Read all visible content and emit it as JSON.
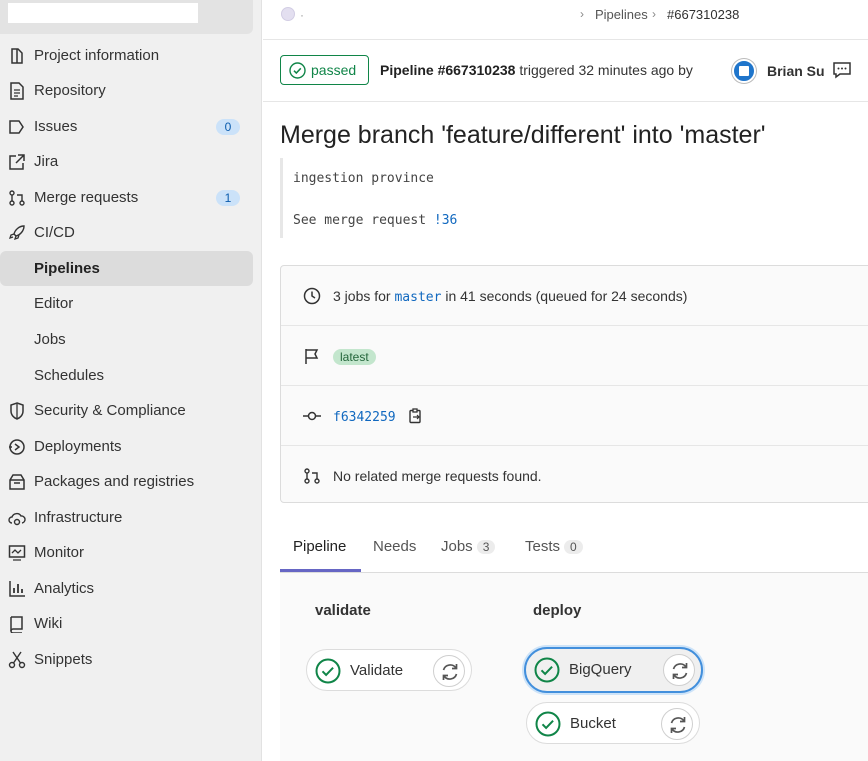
{
  "sidebar": {
    "items": [
      {
        "label": "Project information",
        "icon": "info-icon"
      },
      {
        "label": "Repository",
        "icon": "doc-icon"
      },
      {
        "label": "Issues",
        "icon": "issues-icon",
        "count": "0"
      },
      {
        "label": "Jira",
        "icon": "external-link-icon"
      },
      {
        "label": "Merge requests",
        "icon": "merge-request-icon",
        "count": "1"
      },
      {
        "label": "CI/CD",
        "icon": "rocket-icon"
      },
      {
        "label": "Pipelines"
      },
      {
        "label": "Editor"
      },
      {
        "label": "Jobs"
      },
      {
        "label": "Schedules"
      },
      {
        "label": "Security & Compliance",
        "icon": "shield-icon"
      },
      {
        "label": "Deployments",
        "icon": "deployments-icon"
      },
      {
        "label": "Packages and registries",
        "icon": "package-icon"
      },
      {
        "label": "Infrastructure",
        "icon": "cloud-gear-icon"
      },
      {
        "label": "Monitor",
        "icon": "monitor-icon"
      },
      {
        "label": "Analytics",
        "icon": "chart-icon"
      },
      {
        "label": "Wiki",
        "icon": "book-icon"
      },
      {
        "label": "Snippets",
        "icon": "scissors-icon"
      }
    ]
  },
  "breadcrumb": {
    "dot": "·",
    "sep": "›",
    "items": [
      "Pipelines",
      "#667310238"
    ]
  },
  "header": {
    "status": "passed",
    "pipeline_label": "Pipeline #667310238",
    "triggered_text": "triggered 32 minutes ago by",
    "user_name": "Brian Su"
  },
  "title": "Merge branch 'feature/different' into 'master'",
  "description": {
    "line1": "ingestion province",
    "line2_prefix": "See merge request ",
    "mr_link": "!36"
  },
  "info": {
    "jobs_prefix": "3 jobs for ",
    "branch": "master",
    "jobs_suffix": " in 41 seconds (queued for 24 seconds)",
    "tag": "latest",
    "commit": "f6342259",
    "mr_text": "No related merge requests found."
  },
  "tabs": [
    {
      "label": "Pipeline"
    },
    {
      "label": "Needs"
    },
    {
      "label": "Jobs",
      "count": "3"
    },
    {
      "label": "Tests",
      "count": "0"
    }
  ],
  "stages": [
    {
      "name": "validate",
      "jobs": [
        "Validate"
      ]
    },
    {
      "name": "deploy",
      "jobs": [
        "BigQuery",
        "Bucket"
      ]
    }
  ],
  "colors": {
    "success": "#108548",
    "link": "#1068bf",
    "tab_active": "#6666c4"
  }
}
